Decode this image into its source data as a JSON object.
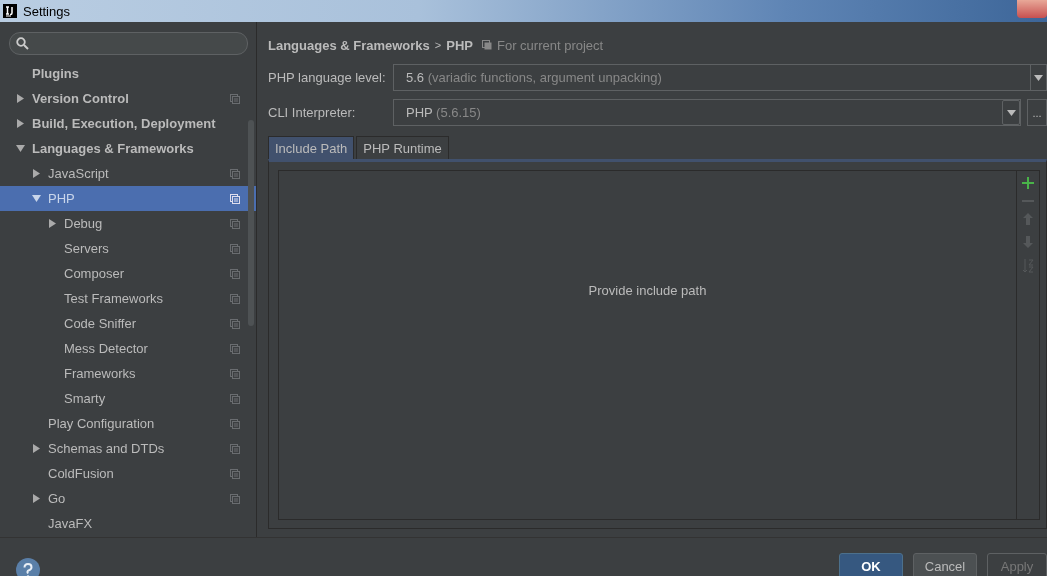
{
  "window": {
    "title": "Settings"
  },
  "sidebar": {
    "tree": [
      {
        "label": "Plugins",
        "selected": false,
        "project_icon": false
      },
      {
        "label": "Version Control",
        "selected": false,
        "project_icon": true,
        "expanded": false
      },
      {
        "label": "Build, Execution, Deployment",
        "selected": false,
        "project_icon": false,
        "expanded": false
      },
      {
        "label": "Languages & Frameworks",
        "selected": false,
        "project_icon": false,
        "expanded": true,
        "children": [
          {
            "label": "JavaScript",
            "selected": false,
            "project_icon": true,
            "expanded": false
          },
          {
            "label": "PHP",
            "selected": true,
            "project_icon": true,
            "expanded": true,
            "children": [
              {
                "label": "Debug",
                "selected": false,
                "project_icon": true,
                "expanded": false
              },
              {
                "label": "Servers",
                "selected": false,
                "project_icon": true
              },
              {
                "label": "Composer",
                "selected": false,
                "project_icon": true
              },
              {
                "label": "Test Frameworks",
                "selected": false,
                "project_icon": true
              },
              {
                "label": "Code Sniffer",
                "selected": false,
                "project_icon": true
              },
              {
                "label": "Mess Detector",
                "selected": false,
                "project_icon": true
              },
              {
                "label": "Frameworks",
                "selected": false,
                "project_icon": true
              },
              {
                "label": "Smarty",
                "selected": false,
                "project_icon": true
              }
            ]
          },
          {
            "label": "Play Configuration",
            "selected": false,
            "project_icon": true
          },
          {
            "label": "Schemas and DTDs",
            "selected": false,
            "project_icon": true,
            "expanded": false
          },
          {
            "label": "ColdFusion",
            "selected": false,
            "project_icon": true
          },
          {
            "label": "Go",
            "selected": false,
            "project_icon": true,
            "expanded": false
          },
          {
            "label": "JavaFX",
            "selected": false,
            "project_icon": false
          }
        ]
      }
    ]
  },
  "breadcrumb": {
    "parent": "Languages & Frameworks",
    "separator": ">",
    "current": "PHP",
    "scope": "For current project"
  },
  "fields": [
    {
      "label": "PHP language level:",
      "value": "5.6",
      "detail": "(variadic functions, argument unpacking)",
      "browse_button": false
    },
    {
      "label": "CLI Interpreter:",
      "value": "PHP",
      "detail": "(5.6.15)",
      "browse_button": true,
      "browse_label": "..."
    }
  ],
  "tabs": [
    {
      "label": "Include Path",
      "selected": true
    },
    {
      "label": "PHP Runtime",
      "selected": false
    }
  ],
  "include_path": {
    "empty_text": "Provide include path"
  },
  "buttons": [
    {
      "label": "OK",
      "kind": "default"
    },
    {
      "label": "Cancel",
      "kind": "normal"
    },
    {
      "label": "Apply",
      "kind": "disabled"
    }
  ]
}
